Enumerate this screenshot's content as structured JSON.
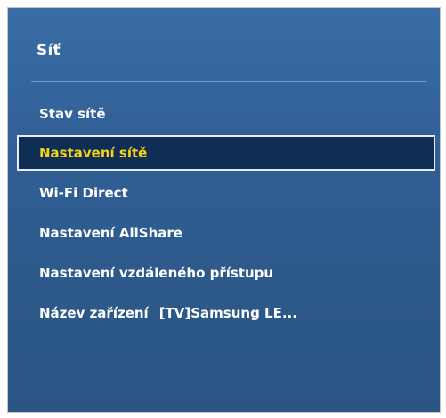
{
  "panel": {
    "title": "Síť"
  },
  "menu": {
    "items": [
      {
        "label": "Stav sítě"
      },
      {
        "label": "Nastavení sítě"
      },
      {
        "label": "Wi-Fi Direct"
      },
      {
        "label": "Nastavení AllShare"
      },
      {
        "label": "Nastavení vzdáleného přístupu"
      },
      {
        "label": "Název zařízení",
        "value": "[TV]Samsung LE..."
      }
    ],
    "selected_index": 1
  },
  "colors": {
    "panel_background": "#315f96",
    "selected_background": "#0f2e55",
    "selected_text": "#f3d21a",
    "text": "#ffffff"
  }
}
